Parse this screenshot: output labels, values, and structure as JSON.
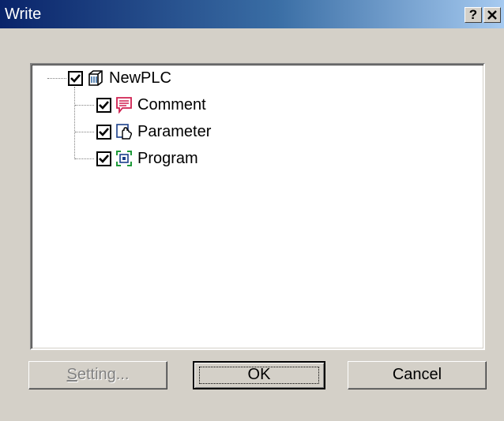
{
  "window": {
    "title": "Write",
    "help_label": "?",
    "close_label": "✕"
  },
  "tree": {
    "root": {
      "label": "NewPLC",
      "checked": true,
      "icon": "plc-cube-icon"
    },
    "children": [
      {
        "label": "Comment",
        "checked": true,
        "icon": "comment-icon"
      },
      {
        "label": "Parameter",
        "checked": true,
        "icon": "parameter-hand-icon"
      },
      {
        "label": "Program",
        "checked": true,
        "icon": "program-icon"
      }
    ]
  },
  "buttons": {
    "setting_mnemonic": "S",
    "setting_rest": "etting...",
    "ok_label": "OK",
    "cancel_label": "Cancel"
  },
  "colors": {
    "title_gradient_start": "#0a246a",
    "title_gradient_end": "#a6caf0",
    "face": "#d4d0c8",
    "comment_icon": "#d02050",
    "program_icon": "#1f9a3a"
  }
}
